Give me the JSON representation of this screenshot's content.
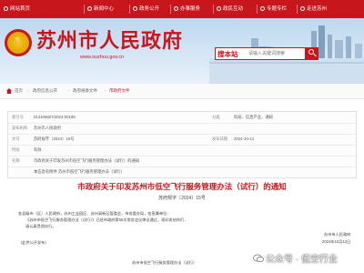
{
  "topbar": {
    "home": "网站首页",
    "date": "今天是2024年10月21日 星期一",
    "news": "新闻中心",
    "open": "政务公开",
    "service": "办事服务",
    "participation": "政民互动",
    "subject": "专题专栏",
    "overview": "走进苏州"
  },
  "header": {
    "site_title": "苏州市人民政府",
    "site_url": "www.suzhou.gov.cn",
    "search_brand": "搜本站",
    "search_placeholder": "请输入关键词搜索"
  },
  "breadcrumb": {
    "items": [
      "首页",
      "政府信息公开",
      "政府规章文件",
      "市政府文件"
    ]
  },
  "meta": {
    "rows": [
      {
        "l1": "索引号",
        "v1": "014106927/2024-00199",
        "l2": "分类",
        "v2": "科技、信息产业，通知"
      },
      {
        "l1": "发布机构",
        "v1": "苏州市人民政府",
        "l2": "",
        "v2": ""
      },
      {
        "l1": "文号",
        "v1": "苏府规字〔2024〕15号",
        "l2": "发布日期",
        "v2": "2024-10-14"
      },
      {
        "l1": "时效",
        "v1": "有效",
        "l2": "",
        "v2": ""
      },
      {
        "l1": "名称",
        "v1": "市政府关于印发苏州市低空飞行服务管理办法（试行）的通知",
        "l2": "",
        "v2": ""
      },
      {
        "l1": "",
        "v1": "本信息有附件 苏州市低空飞行服务管理办法（试行）",
        "l2": "",
        "v2": ""
      }
    ]
  },
  "article": {
    "title": "市政府关于印发苏州市低空飞行服务管理办法（试行）的通知",
    "number": "苏府规字〔2024〕15号",
    "p1": "各县级市（区）人民政府，苏州工业园区、苏州高新区管委会，市各委办局，各直属单位：",
    "p2": "《苏州市低空飞行服务管理办法（试行）》已经市政府第55次常务会议审议通过，现印发给你们，",
    "p3": "请认真贯彻执行。",
    "p4": "（此件公开发布）",
    "sign_org": "苏州市人民政府",
    "sign_date": "2024年10月13日",
    "attachment": "苏州市低空飞行服务管理办法（试行）"
  },
  "watermark": {
    "text": "公众号 · 低空行业"
  },
  "colors": {
    "brand_red": "#c8161d",
    "banner_sky": "#bcd7ef"
  }
}
